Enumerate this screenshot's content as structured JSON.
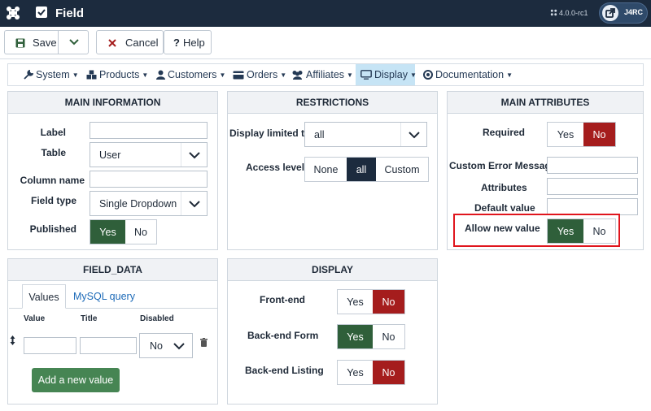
{
  "topbar": {
    "title": "Field",
    "version": "4.0.0-rc1",
    "user": "J4RC"
  },
  "toolbar": {
    "save_label": "Save",
    "cancel_label": "Cancel",
    "help_label": "Help"
  },
  "menu": {
    "items": [
      {
        "label": "System",
        "icon": "wrench-icon"
      },
      {
        "label": "Products",
        "icon": "cubes-icon"
      },
      {
        "label": "Customers",
        "icon": "user-icon"
      },
      {
        "label": "Orders",
        "icon": "credit-card-icon"
      },
      {
        "label": "Affiliates",
        "icon": "users-icon"
      },
      {
        "label": "Display",
        "icon": "desktop-icon",
        "active": true
      },
      {
        "label": "Documentation",
        "icon": "life-ring-icon"
      }
    ]
  },
  "main_info": {
    "heading": "MAIN INFORMATION",
    "label_label": "Label",
    "label_value": "",
    "table_label": "Table",
    "table_value": "User",
    "column_label": "Column name",
    "column_value": "",
    "field_type_label": "Field type",
    "field_type_value": "Single Dropdown",
    "published_label": "Published",
    "published_yes": "Yes",
    "published_no": "No",
    "published_selected": "Yes"
  },
  "restrictions": {
    "heading": "RESTRICTIONS",
    "display_limited_label": "Display limited to",
    "display_limited_value": "all",
    "access_label": "Access level",
    "access_options": [
      "None",
      "all",
      "Custom"
    ],
    "access_selected": "all"
  },
  "main_attributes": {
    "heading": "MAIN ATTRIBUTES",
    "required_label": "Required",
    "required_yes": "Yes",
    "required_no": "No",
    "required_selected": "No",
    "custom_error_label": "Custom Error Message",
    "attributes_label": "Attributes",
    "default_value_label": "Default value",
    "allow_new_label": "Allow new value",
    "allow_new_yes": "Yes",
    "allow_new_no": "No",
    "allow_new_selected": "Yes"
  },
  "field_data": {
    "heading": "FIELD_DATA",
    "tab_values": "Values",
    "tab_mysql": "MySQL query",
    "col_value": "Value",
    "col_title": "Title",
    "col_disabled": "Disabled",
    "row_disabled_value": "No",
    "add_button": "Add a new value"
  },
  "display": {
    "heading": "DISPLAY",
    "frontend_label": "Front-end",
    "frontend_yes": "Yes",
    "frontend_no": "No",
    "frontend_selected": "No",
    "backend_form_label": "Back-end Form",
    "backend_form_yes": "Yes",
    "backend_form_no": "No",
    "backend_form_selected": "Yes",
    "backend_listing_label": "Back-end Listing",
    "backend_listing_yes": "Yes",
    "backend_listing_no": "No",
    "backend_listing_selected": "No"
  },
  "colors": {
    "topbar": "#1c2b3e",
    "green": "#2f5f3a",
    "red": "#a51d1d",
    "highlight": "#e0151d",
    "active_menu": "#c6e4f5"
  }
}
